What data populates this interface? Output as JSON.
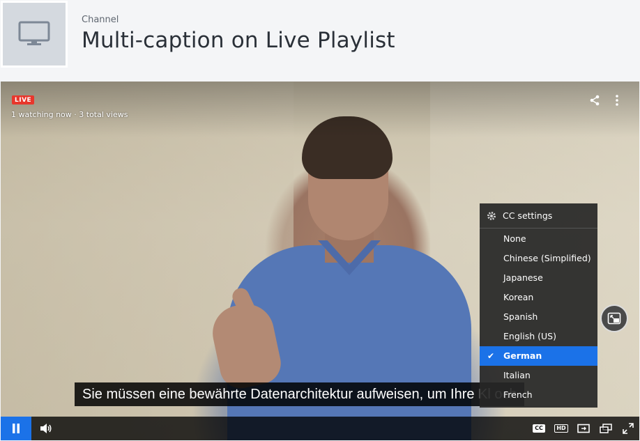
{
  "header": {
    "label": "Channel",
    "title": "Multi-caption on Live Playlist"
  },
  "player": {
    "live_badge": "LIVE",
    "viewers": "1 watching now · 3 total views",
    "subtitle": "Sie müssen eine bewährte Datenarchitektur aufweisen, um Ihre Kl    och",
    "cc_menu": {
      "settings_label": "CC settings",
      "items": [
        "None",
        "Chinese (Simplified)",
        "Japanese",
        "Korean",
        "Spanish",
        "English (US)",
        "German",
        "Italian",
        "French"
      ],
      "selected": "German"
    },
    "controls": {
      "cc_label": "CC",
      "hd_label": "HD"
    }
  },
  "colors": {
    "accent": "#1b72e8",
    "live": "#e8372c"
  },
  "icons": [
    "monitor-icon",
    "share-icon",
    "more-vertical-icon",
    "gear-icon",
    "check-icon",
    "pip-icon",
    "pause-icon",
    "volume-icon",
    "theater-icon",
    "popout-icon",
    "fullscreen-icon"
  ]
}
